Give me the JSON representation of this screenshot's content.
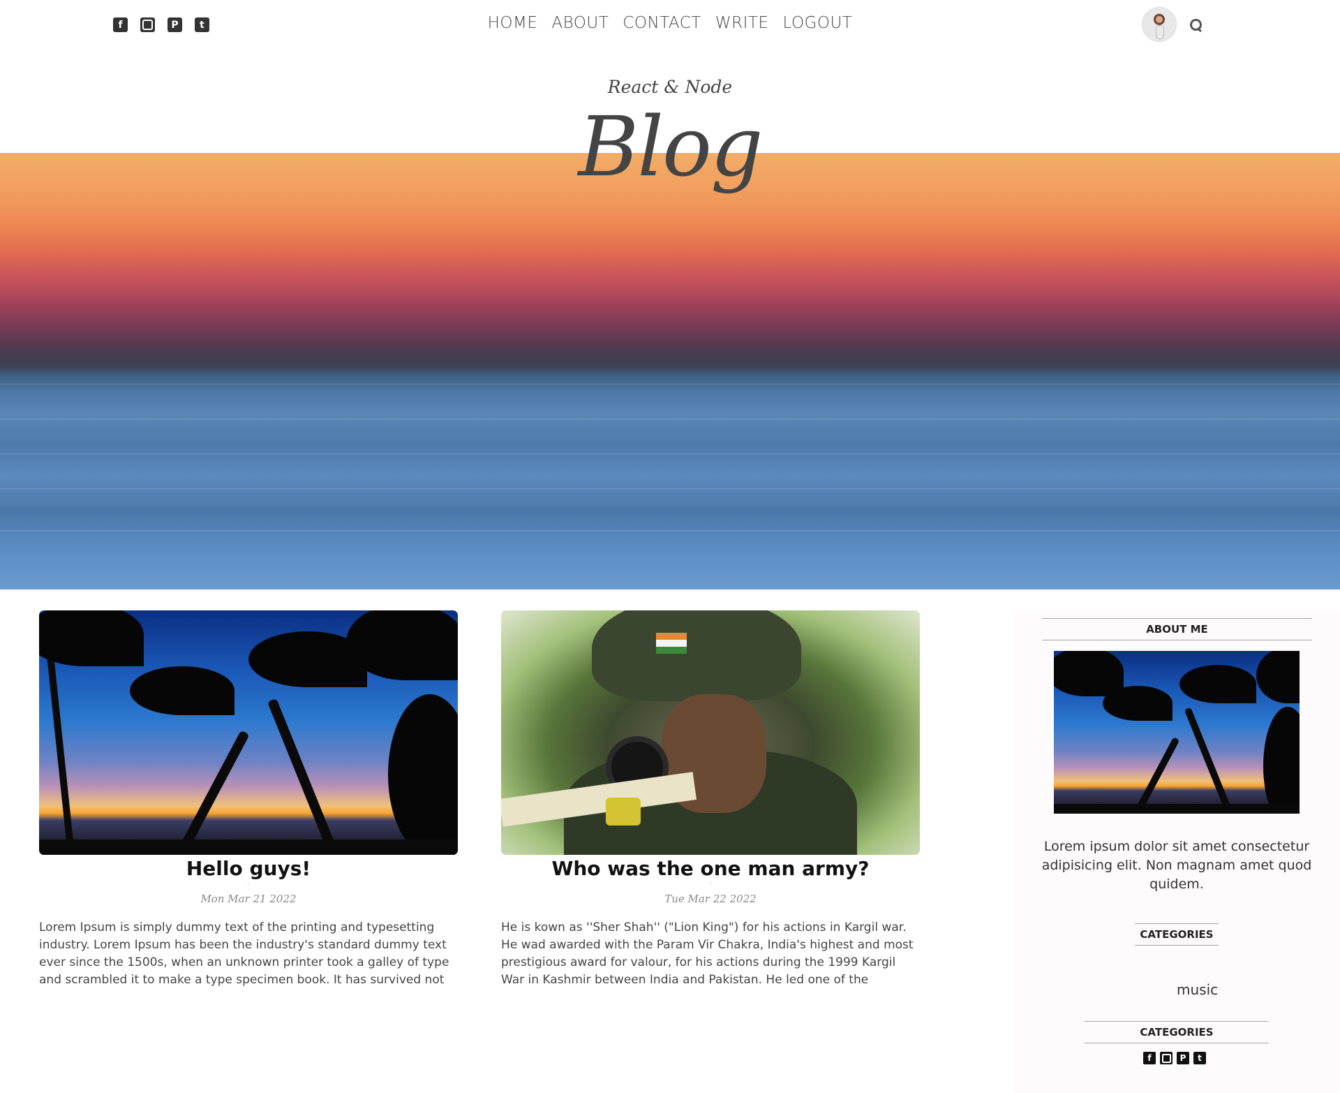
{
  "header": {
    "social_icons": [
      "facebook-square-icon",
      "instagram-square-icon",
      "pinterest-square-icon",
      "twitter-square-icon"
    ],
    "nav": [
      "HOME",
      "ABOUT",
      "CONTACT",
      "WRITE",
      "LOGOUT"
    ]
  },
  "hero": {
    "subtitle": "React & Node",
    "title": "Blog"
  },
  "posts": [
    {
      "title": "Hello guys!",
      "date": "Mon Mar 21 2022",
      "desc": "Lorem Ipsum is simply dummy text of the printing and typesetting industry. Lorem Ipsum has been the industry's standard dummy text ever since the 1500s, when an unknown printer took a galley of type and scrambled it to make a type specimen book. It has survived not on…"
    },
    {
      "title": "Who was the one man army?",
      "date": "Tue Mar 22 2022",
      "desc": "He is kown as ''Sher Shah'' (\"Lion King\") for his actions in Kargil war. He wad awarded with the Param Vir Chakra, India's highest and most prestigious award for valour, for his actions during the 1999 Kargil War in Kashmir between India and Pakistan. He led one of the toughest…"
    }
  ],
  "sidebar": {
    "about_heading": "ABOUT ME",
    "about_text": "Lorem ipsum dolor sit amet consectetur adipisicing elit. Non magnam amet quod quidem.",
    "categories_heading": "CATEGORIES",
    "categories": [
      "music"
    ],
    "follow_heading": "CATEGORIES"
  },
  "colors": {
    "text": "#444444",
    "heading": "#111111",
    "sidebar_bg": "#fdfbfb"
  }
}
